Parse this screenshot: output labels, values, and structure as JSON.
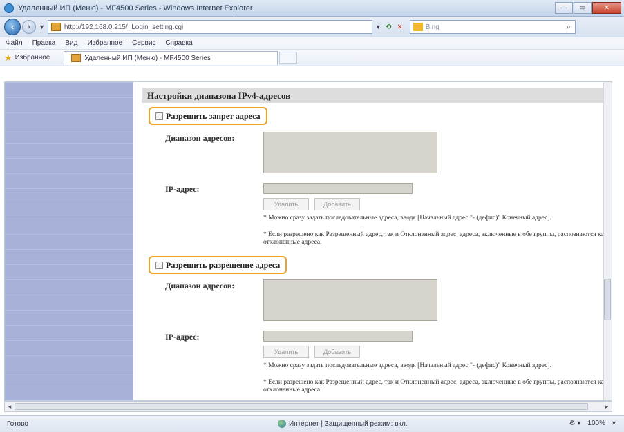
{
  "window": {
    "title": "Удаленный ИП (Меню) - MF4500 Series - Windows Internet Explorer",
    "minimize": "—",
    "maximize": "▭",
    "close": "✕"
  },
  "address": {
    "url": "http://192.168.0.215/_Login_setting.cgi",
    "search_placeholder": "Bing"
  },
  "menu": [
    "Файл",
    "Правка",
    "Вид",
    "Избранное",
    "Сервис",
    "Справка"
  ],
  "favorites": {
    "label": "Избранное",
    "tab_title": "Удаленный ИП (Меню) - MF4500 Series"
  },
  "page": {
    "section_title": "Настройки диапазона IPv4-адресов",
    "block1": {
      "checkbox_label": "Разрешить запрет адреса",
      "range_label": "Диапазон адресов:",
      "ip_label": "IP-адрес:",
      "delete_button": "Удалить",
      "add_button": "Добавить",
      "note1": "* Можно сразу задать последовательные адреса, вводя [Начальный адрес \"- (дефис)\" Конечный адрес].",
      "note2": "* Если разрешено как Разрешенный адрес, так и Отклоненный адрес, адреса, включенные в обе группы, распознаются как отклоненные адреса."
    },
    "block2": {
      "checkbox_label": "Разрешить разрешение адреса",
      "range_label": "Диапазон адресов:",
      "ip_label": "IP-адрес:",
      "delete_button": "Удалить",
      "add_button": "Добавить",
      "note1": "* Можно сразу задать последовательные адреса, вводя [Начальный адрес \"- (дефис)\" Конечный адрес].",
      "note2": "* Если разрешено как Разрешенный адрес, так и Отклоненный адрес, адреса, включенные в обе группы, распознаются как отклоненные адреса."
    }
  },
  "status": {
    "ready": "Готово",
    "zone": "Интернет | Защищенный режим: вкл.",
    "zoom": "100%"
  }
}
